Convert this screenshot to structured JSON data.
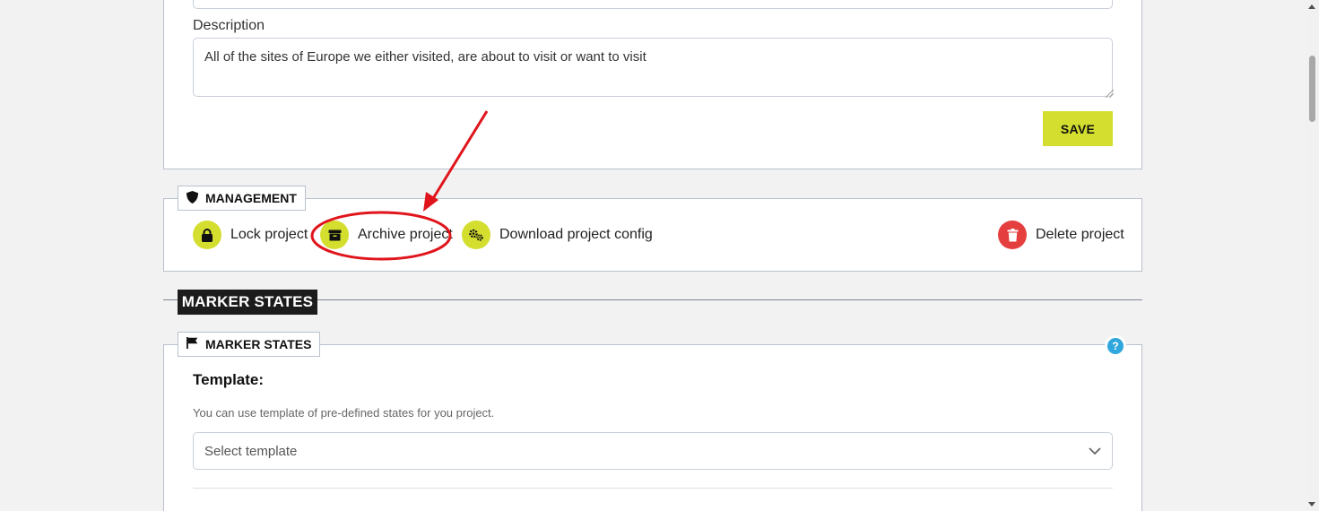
{
  "project_form": {
    "description_label": "Description",
    "description_value": "All of the sites of Europe we either visited, are about to visit or want to visit",
    "save_label": "SAVE"
  },
  "management": {
    "legend": "MANAGEMENT",
    "lock_label": "Lock project",
    "archive_label": "Archive project",
    "download_label": "Download project config",
    "delete_label": "Delete project"
  },
  "marker_states_section": {
    "title": "MARKER STATES",
    "legend": "MARKER STATES",
    "help_label": "?",
    "template_title": "Template:",
    "template_hint": "You can use template of pre-defined states for you project.",
    "select_placeholder": "Select template"
  },
  "colors": {
    "accent": "#d4de2e",
    "danger": "#e53e3e",
    "annotation": "#e0141b",
    "help": "#2fa6dd"
  },
  "icons": [
    "shield-icon",
    "lock-icon",
    "archive-icon",
    "gears-icon",
    "trash-icon",
    "flag-icon",
    "chevron-down-icon",
    "help-icon"
  ]
}
